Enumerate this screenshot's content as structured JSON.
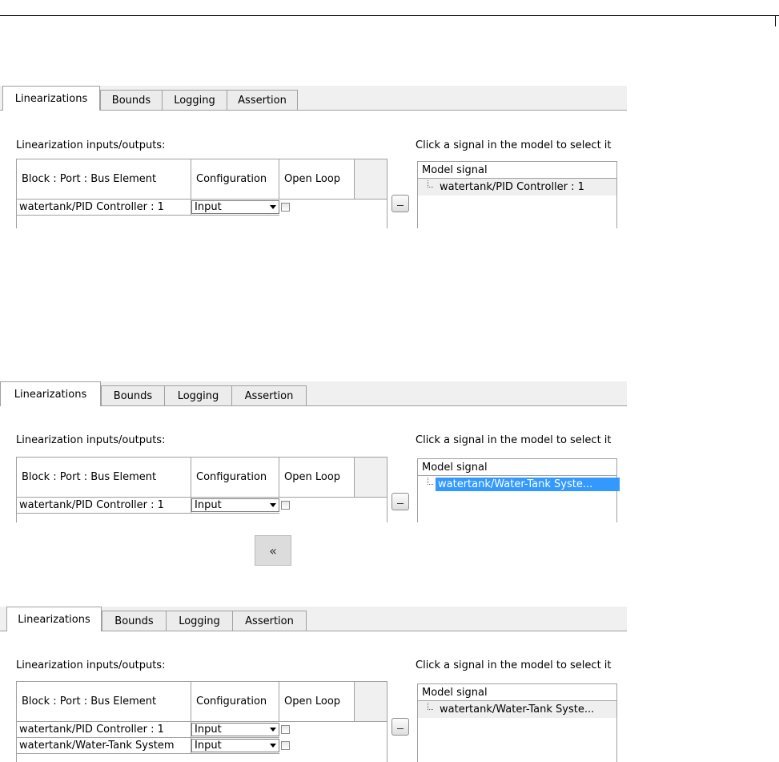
{
  "tabs": [
    "Linearizations",
    "Bounds",
    "Logging",
    "Assertion"
  ],
  "io_label": "Linearization inputs/outputs:",
  "hint": "Click a signal in the model to select it",
  "table_headers": {
    "block": "Block : Port : Bus Element",
    "configuration": "Configuration",
    "open_loop": "Open Loop"
  },
  "tree_header": "Model signal",
  "transfer_button": "«",
  "panels": [
    {
      "rows": [
        {
          "block": "watertank/PID Controller : 1",
          "configuration": "Input",
          "open_loop": false
        }
      ],
      "model_signal": "watertank/PID Controller : 1",
      "signal_selected": false
    },
    {
      "rows": [
        {
          "block": "watertank/PID Controller : 1",
          "configuration": "Input",
          "open_loop": false
        }
      ],
      "model_signal": "watertank/Water-Tank Syste...",
      "signal_selected": true
    },
    {
      "rows": [
        {
          "block": "watertank/PID Controller : 1",
          "configuration": "Input",
          "open_loop": false
        },
        {
          "block": "watertank/Water-Tank System",
          "configuration": "Input",
          "open_loop": false
        }
      ],
      "model_signal": "watertank/Water-Tank Syste...",
      "signal_selected": false
    }
  ]
}
